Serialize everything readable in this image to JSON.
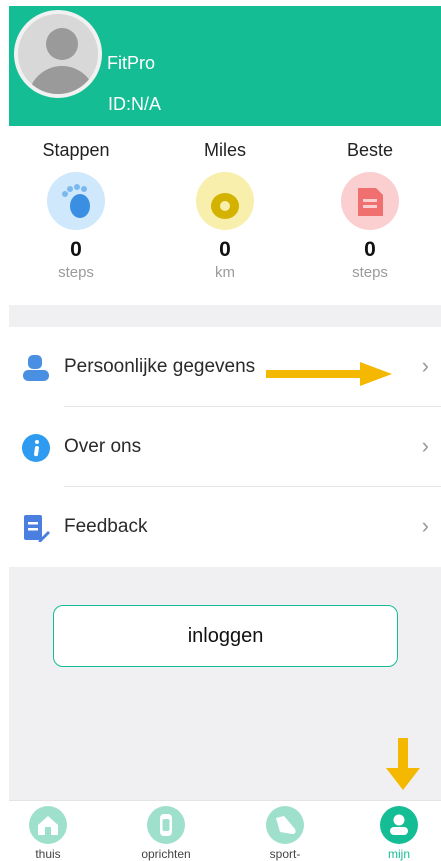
{
  "profile": {
    "app_name": "FitPro",
    "id_label": "ID:N/A"
  },
  "stats": [
    {
      "title": "Stappen",
      "value": "0",
      "unit": "steps",
      "icon": "footprint-icon"
    },
    {
      "title": "Miles",
      "value": "0",
      "unit": "km",
      "icon": "location-pin-icon"
    },
    {
      "title": "Beste",
      "value": "0",
      "unit": "steps",
      "icon": "document-icon"
    }
  ],
  "menu": [
    {
      "label": "Persoonlijke gegevens",
      "icon": "person-icon"
    },
    {
      "label": "Over ons",
      "icon": "info-icon"
    },
    {
      "label": "Feedback",
      "icon": "feedback-edit-icon"
    }
  ],
  "login": {
    "label": "inloggen"
  },
  "tabs": [
    {
      "label": "thuis",
      "icon": "home-icon",
      "active": false
    },
    {
      "label": "oprichten",
      "icon": "watch-icon",
      "active": false
    },
    {
      "label": "sport-",
      "icon": "shoe-icon",
      "active": false
    },
    {
      "label": "mijn",
      "icon": "user-icon",
      "active": true
    }
  ],
  "colors": {
    "accent": "#15bd95",
    "annotation_arrow": "#f5b800",
    "band": "#f0f0f2"
  }
}
